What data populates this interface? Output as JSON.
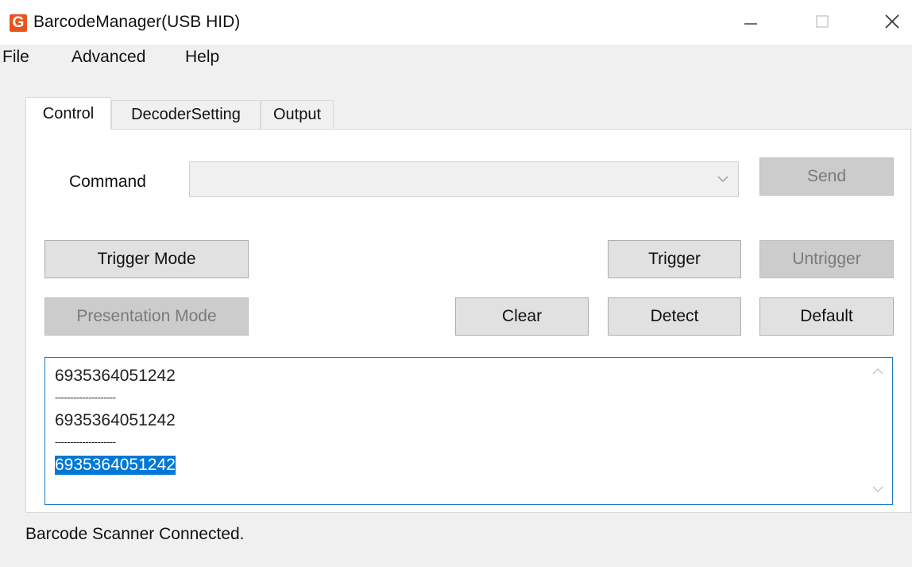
{
  "window": {
    "title": "BarcodeManager(USB HID)",
    "app_icon_letter": "G",
    "accent_color": "#0078d7",
    "icon_color": "#e8541e"
  },
  "menu": {
    "items": [
      "File",
      "Advanced",
      "Help"
    ]
  },
  "tabs": {
    "items": [
      "Control",
      "DecoderSetting",
      "Output"
    ],
    "active": "Control"
  },
  "control": {
    "command_label": "Command",
    "command_value": "",
    "send_label": "Send",
    "trigger_mode_label": "Trigger Mode",
    "trigger_label": "Trigger",
    "untrigger_label": "Untrigger",
    "presentation_mode_label": "Presentation Mode",
    "clear_label": "Clear",
    "detect_label": "Detect",
    "default_label": "Default"
  },
  "output_log": {
    "lines": [
      "6935364051242",
      "--------------------",
      "6935364051242",
      "--------------------",
      "6935364051242"
    ],
    "selected_line_index": 4
  },
  "status": {
    "text": "Barcode Scanner Connected."
  },
  "icons": {
    "minimize": "minimize-icon",
    "maximize": "maximize-icon",
    "close": "close-icon",
    "dropdown": "chevron-down-icon",
    "scroll_up": "scroll-up-arrow-icon",
    "scroll_down": "scroll-down-arrow-icon"
  }
}
